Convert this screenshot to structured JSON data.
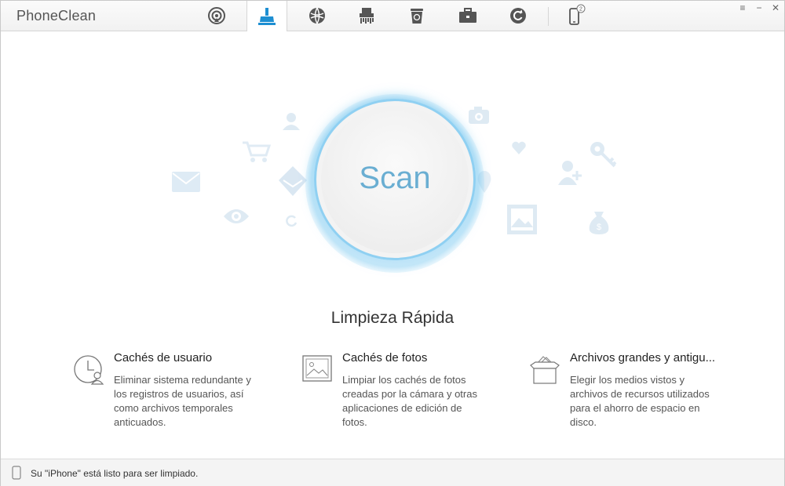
{
  "app": {
    "title": "PhoneClean"
  },
  "toolbar": {
    "tools": [
      {
        "name": "airplay-icon"
      },
      {
        "name": "broom-clean-icon",
        "active": true
      },
      {
        "name": "globe-icon"
      },
      {
        "name": "shredder-icon"
      },
      {
        "name": "recycle-bin-icon"
      },
      {
        "name": "toolbox-icon"
      },
      {
        "name": "refresh-icon"
      }
    ],
    "device_badge": "2",
    "window_buttons": {
      "menu": "≡",
      "minimize": "−",
      "close": "✕"
    }
  },
  "main": {
    "scan_label": "Scan",
    "section_title": "Limpieza Rápida",
    "features": [
      {
        "icon": "user-clock-icon",
        "title": "Cachés de usuario",
        "description": "Eliminar sistema redundante y los registros de usuarios, así como archivos temporales anticuados."
      },
      {
        "icon": "photo-icon",
        "title": "Cachés de fotos",
        "description": "Limpiar los cachés de fotos creadas por la cámara y otras aplicaciones de edición de fotos."
      },
      {
        "icon": "archive-box-icon",
        "title": "Archivos grandes y antigu...",
        "description": "Elegir los medios vistos y archivos de recursos utilizados para el ahorro de espacio en disco."
      }
    ]
  },
  "status": {
    "text": "Su \"iPhone\" está listo para ser limpiado."
  },
  "colors": {
    "accent": "#1e8fd2",
    "scan_text": "#6aaed2",
    "ring": "#8fd0f2",
    "bg_icons": "#d6e9f5"
  }
}
